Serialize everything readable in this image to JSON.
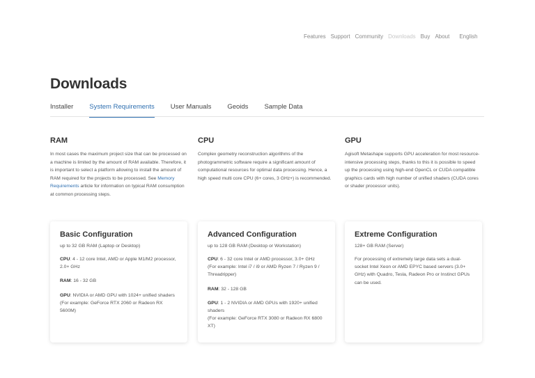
{
  "nav": {
    "items": [
      {
        "label": "Features",
        "active": false
      },
      {
        "label": "Support",
        "active": false
      },
      {
        "label": "Community",
        "active": false
      },
      {
        "label": "Downloads",
        "active": true
      },
      {
        "label": "Buy",
        "active": false
      },
      {
        "label": "About",
        "active": false
      }
    ],
    "language": "English"
  },
  "page": {
    "title": "Downloads",
    "tabs": [
      {
        "label": "Installer",
        "active": false
      },
      {
        "label": "System Requirements",
        "active": true
      },
      {
        "label": "User Manuals",
        "active": false
      },
      {
        "label": "Geoids",
        "active": false
      },
      {
        "label": "Sample Data",
        "active": false
      }
    ]
  },
  "requirements": {
    "ram": {
      "title": "RAM",
      "text_before": "In most cases the maximum project size that can be processed on a machine is limited by the amount of RAM available. Therefore, it is important to select a platform allowing to install the amount of RAM required for the projects to be processed. See ",
      "link": "Memory Requirements",
      "text_after": " article for information on typical RAM consumption at common processing steps."
    },
    "cpu": {
      "title": "CPU",
      "text": "Complex geometry reconstruction algorithms of the photogrammetric software require a significant amount of computational resources for optimal data processing. Hence, a high speed multi core CPU (6+ cores, 3 GHz+) is recommended."
    },
    "gpu": {
      "title": "GPU",
      "text": "Agisoft Metashape supports GPU acceleration for most resource-intensive processing steps, thanks to this it is possible to speed up the processing using high-end OpenCL or CUDA compatible graphics cards with high number of unified shaders (CUDA cores or shader processor units)."
    }
  },
  "configs": {
    "basic": {
      "title": "Basic Configuration",
      "subtitle": "up to 32 GB RAM (Laptop or Desktop)",
      "cpu_label": "CPU",
      "cpu": ": 4 - 12 core Intel, AMD or Apple M1/M2 processor, 2.0+ GHz",
      "ram_label": "RAM",
      "ram": ": 16 - 32 GB",
      "gpu_label": "GPU",
      "gpu": ": NVIDIA or AMD GPU with 1024+ unified shaders",
      "gpu_example": "(For example: GeForce RTX 2060 or Radeon RX 5600M)"
    },
    "advanced": {
      "title": "Advanced Configuration",
      "subtitle": "up to 128 GB RAM (Desktop or Workstation)",
      "cpu_label": "CPU",
      "cpu": ": 6 - 32 core Intel or AMD processor, 3.0+ GHz",
      "cpu_example": "(For example: Intel i7 / i9 or AMD Ryzen 7 / Ryzen 9 / Threadripper)",
      "ram_label": "RAM",
      "ram": ": 32 - 128 GB",
      "gpu_label": "GPU",
      "gpu": ": 1 - 2 NVIDIA or AMD GPUs with 1920+ unified shaders",
      "gpu_example": "(For example: GeForce RTX 3080 or Radeon RX 6800 XT)"
    },
    "extreme": {
      "title": "Extreme Configuration",
      "subtitle": "128+ GB RAM (Server)",
      "text": "For processing of extremely large data sets a dual-socket Intel Xeon or AMD EPYC based servers (3.0+ GHz) with Quadro, Tesla, Radeon Pro or Instinct GPUs can be used."
    }
  },
  "colors": {
    "accent": "#2e6fb0",
    "inactive_nav": "#c8c8c8"
  }
}
